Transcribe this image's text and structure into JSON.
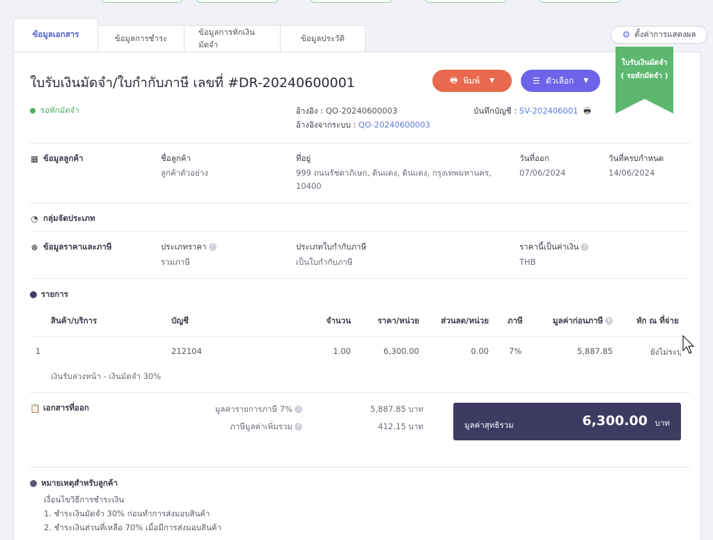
{
  "tabs": [
    "ข้อมูลเอกสาร",
    "ข้อมูลการชำระ",
    "ข้อมูลการหักเงินมัดจำ",
    "ข้อมูลประวัติ"
  ],
  "settings_label": "ตั้งค่าการแสดงผล",
  "ribbon": {
    "line1": "ใบรับเงินมัดจำ",
    "line2": "( รอหักมัดจำ )"
  },
  "document": {
    "title": "ใบรับเงินมัดจำ/ใบกำกับภาษี เลขที่ #DR-20240600001",
    "status": "รอหักมัดจำ",
    "print_label": "พิมพ์",
    "options_label": "ตัวเลือก",
    "ref_label": "อ้างอิง :",
    "ref_value": "QO-20240600003",
    "sys_ref_label": "อ้างอิงจากระบบ :",
    "sys_ref_value": "QO-20240600003",
    "account_label": "บันทึกบัญชี :",
    "account_value": "SV-202406001"
  },
  "customer": {
    "section": "ข้อมูลลูกค้า",
    "name_label": "ชื่อลูกค้า",
    "name_value": "ลูกค้าตัวอย่าง",
    "address_label": "ที่อยู่",
    "address_line1": "999 ถนนรัชดาภิเษก, ดินแดง, ดินแดง, กรุงเทพมหานคร,",
    "address_line2": "10400",
    "issue_label": "วันที่ออก",
    "issue_value": "07/06/2024",
    "due_label": "วันที่ครบกำหนด",
    "due_value": "14/06/2024"
  },
  "group": {
    "section": "กลุ่มจัดประเภท"
  },
  "pricing": {
    "section": "ข้อมูลราคาและภาษี",
    "price_type_label": "ประเภทราคา",
    "price_type_value": "รวมภาษี",
    "tax_inv_label": "ประเภทใบกำกับภาษี",
    "tax_inv_value": "เป็นใบกำกับภาษี",
    "currency_label": "ราคานี้เป็นค่าเงิน",
    "currency_value": "THB"
  },
  "items": {
    "section": "รายการ",
    "headers": [
      "สินค้า/บริการ",
      "บัญชี",
      "จำนวน",
      "ราคา/หน่วย",
      "ส่วนลด/หน่วย",
      "ภาษี",
      "มูลค่าก่อนภาษี",
      "หัก ณ ที่จ่าย"
    ],
    "row": {
      "no": "1",
      "account": "212104",
      "qty": "1.00",
      "price": "6,300.00",
      "discount": "0.00",
      "tax": "7%",
      "pretax": "5,887.85",
      "wht": "ยังไม่ระบุ",
      "desc": "เงินรับล่วงหน้า - เงินมัดจำ 30%"
    }
  },
  "summary": {
    "section": "เอกสารที่ออก",
    "taxable_label": "มูลค่ารายการภาษี 7%",
    "taxable_value": "5,887.85 บาท",
    "vat_label": "ภาษีมูลค่าเพิ่มรวม",
    "vat_value": "412.15 บาท",
    "net_label": "มูลค่าสุทธิรวม",
    "net_value": "6,300.00",
    "net_unit": "บาท"
  },
  "notes": {
    "section": "หมายเหตุสำหรับลูกค้า",
    "lines": [
      "เงื่อนไขวิธีการชำระเงิน",
      "1. ชำระเงินมัดจำ 30% ก่อนทำการส่งมอบสินค้า",
      "2. ชำระเงินส่วนที่เหลือ 70% เมื่อมีการส่งมอบสินค้า"
    ]
  },
  "colors": {
    "primary": "#5b7bdc",
    "print_button": "#e8694d",
    "options_button": "#6c63e8",
    "status_green": "#4caf64",
    "ribbon_green": "#5bb86e",
    "net_box": "#3e3b63"
  }
}
